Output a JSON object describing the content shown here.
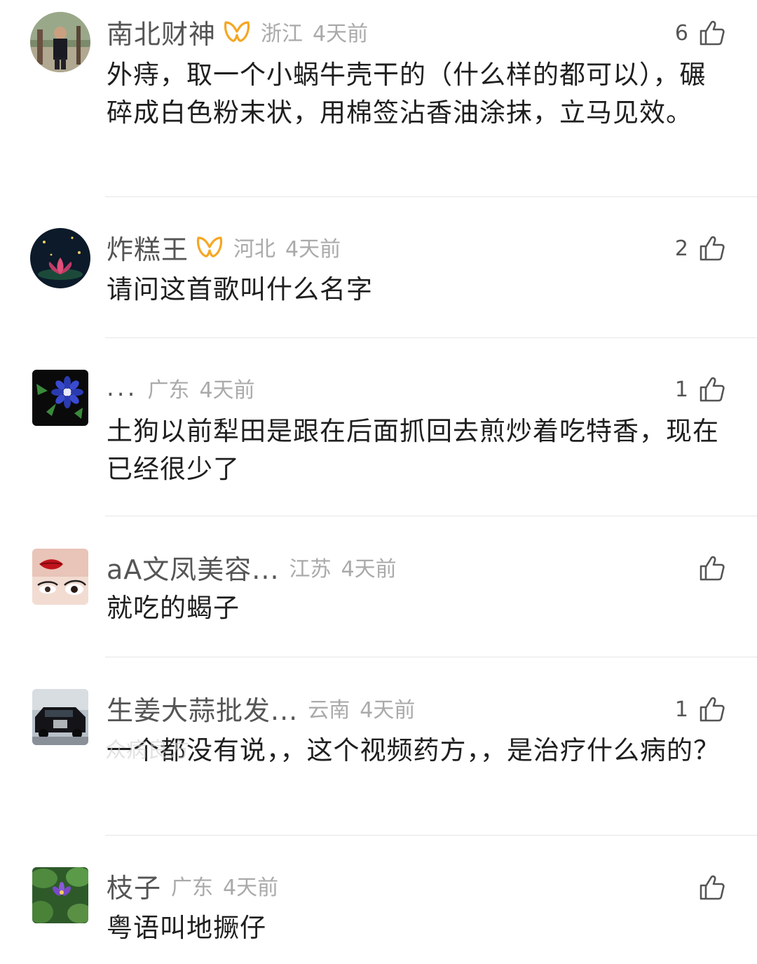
{
  "comments": [
    {
      "username": "南北财神",
      "vip": true,
      "location": "浙江",
      "time": "4天前",
      "likes": "6",
      "text": "外痔，取一个小蜗牛壳干的（什么样的都可以），碾碎成白色粉末状，用棉签沾香油涂抹，立马见效。"
    },
    {
      "username": "炸糕王",
      "vip": true,
      "location": "河北",
      "time": "4天前",
      "likes": "2",
      "text": "请问这首歌叫什么名字"
    },
    {
      "username": "...",
      "vip": false,
      "location": "广东",
      "time": "4天前",
      "likes": "1",
      "text": "土狗以前犁田是跟在后面抓回去煎炒着吃特香，现在已经很少了"
    },
    {
      "username": "aA文凤美容...",
      "vip": false,
      "location": "江苏",
      "time": "4天前",
      "likes": "",
      "text": "就吃的蝎子"
    },
    {
      "username": "生姜大蒜批发...",
      "vip": false,
      "location": "云南",
      "time": "4天前",
      "likes": "1",
      "text": "一个都没有说，，这个视频药方，，是治疗什么病的？"
    },
    {
      "username": "枝子",
      "vip": false,
      "location": "广东",
      "time": "4天前",
      "likes": "",
      "text": "粤语叫地撅仔"
    }
  ],
  "watermark": "众病良方",
  "colors": {
    "vip_badge": "#f5a623",
    "meta_gray": "#aaaaaa",
    "name_gray": "#555555",
    "divider": "#e6e6e6"
  },
  "icons": {
    "like": "thumbs-up-icon",
    "vip": "vip-badge-icon"
  }
}
